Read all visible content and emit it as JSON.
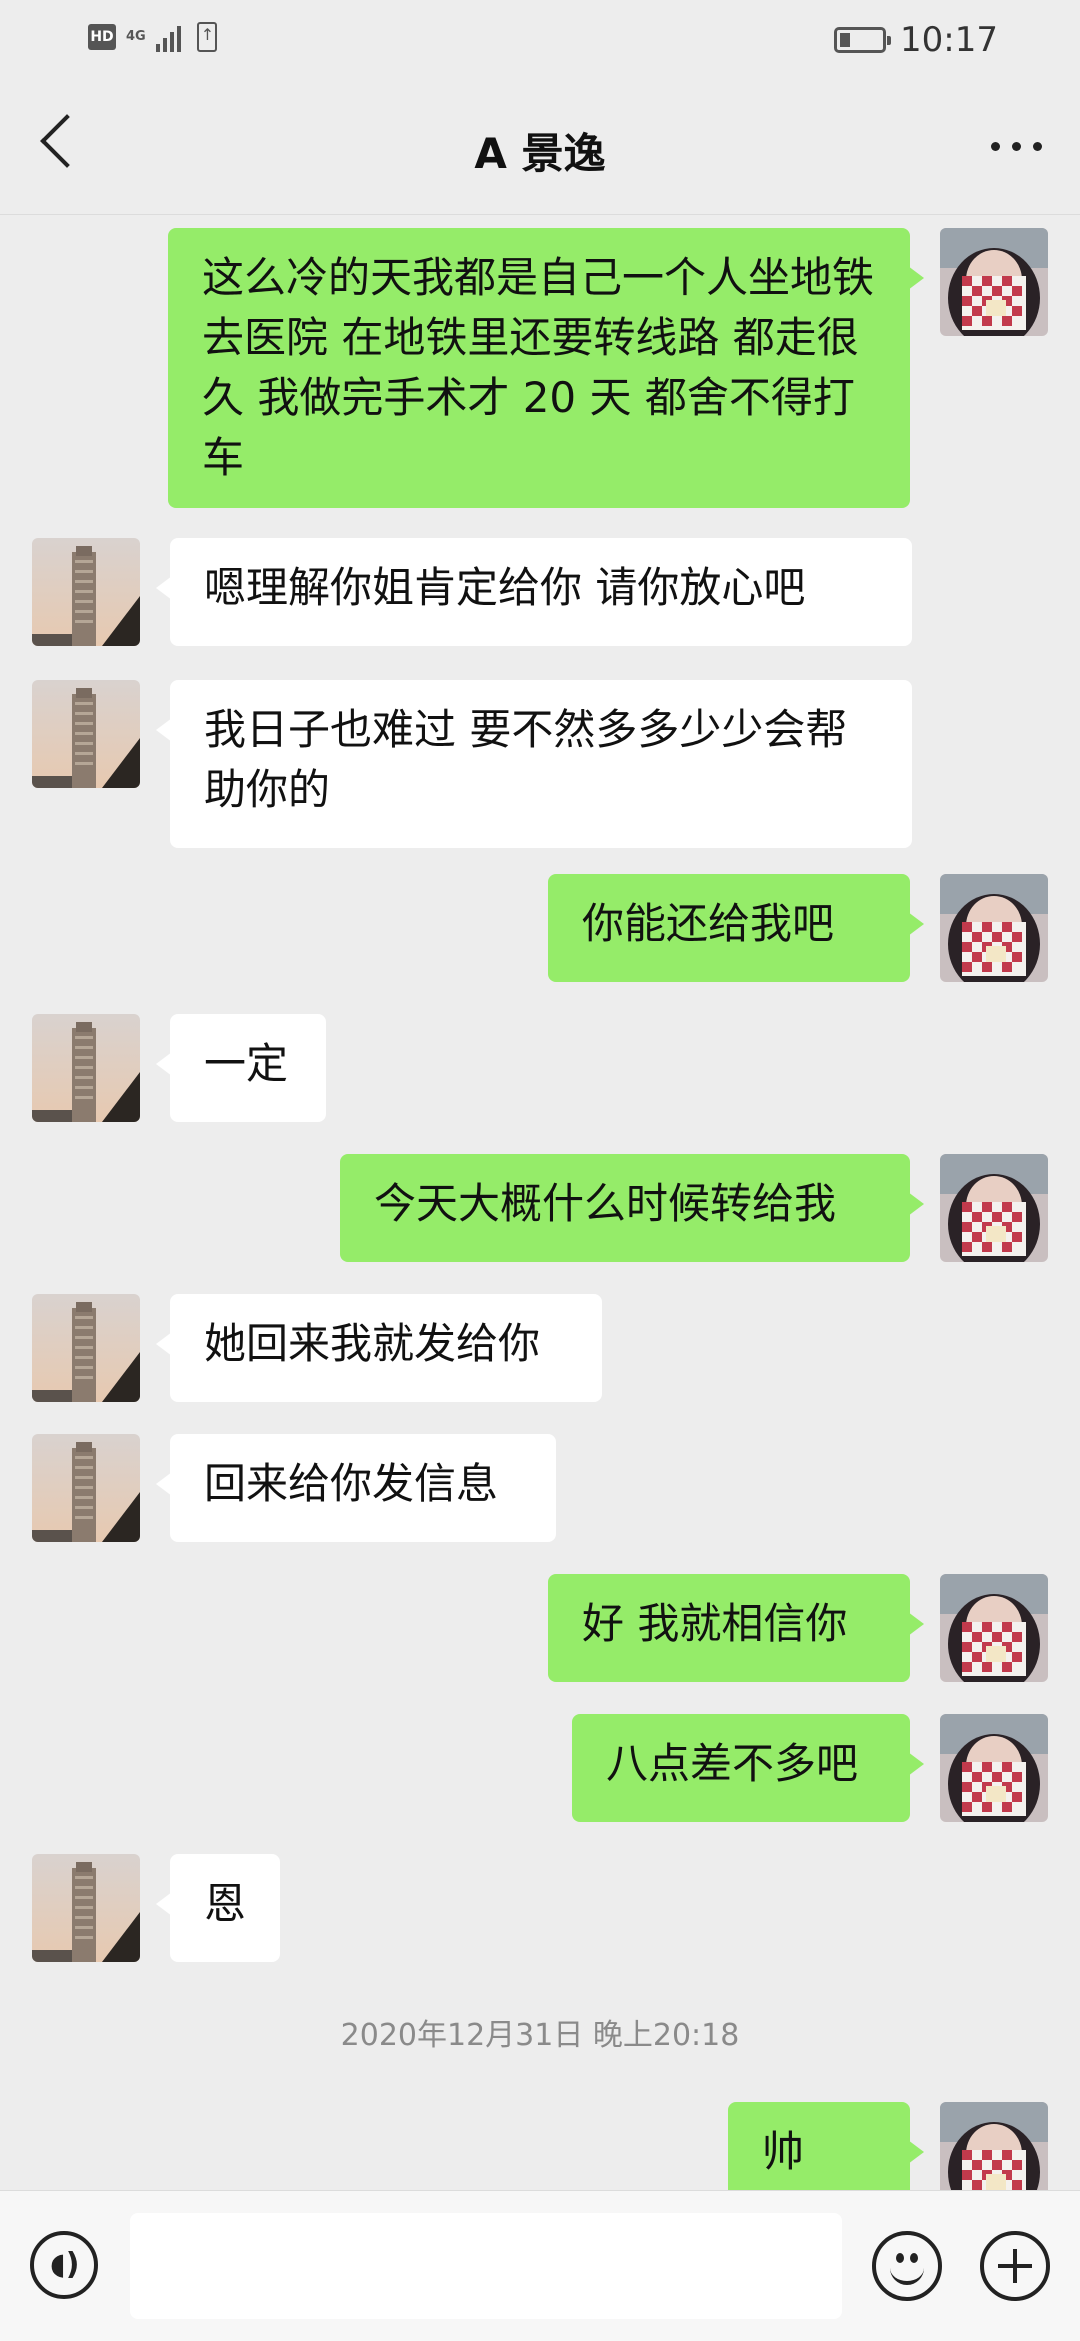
{
  "status_bar": {
    "hd": "HD",
    "network": "4G",
    "time": "10:17"
  },
  "header": {
    "title": "A 景逸"
  },
  "messages": [
    {
      "side": "sent",
      "text": "这么冷的天我都是自己一个人坐地铁去医院  在地铁里还要转线路 都走很久 我做完手术才 20 天  都舍不得打车"
    },
    {
      "side": "recv",
      "text": "嗯理解你姐肯定给你 请你放心吧"
    },
    {
      "side": "recv",
      "text": "我日子也难过 要不然多多少少会帮助你的"
    },
    {
      "side": "sent",
      "text": "你能还给我吧"
    },
    {
      "side": "recv",
      "text": "一定"
    },
    {
      "side": "sent",
      "text": "今天大概什么时候转给我"
    },
    {
      "side": "recv",
      "text": "她回来我就发给你"
    },
    {
      "side": "recv",
      "text": "回来给你发信息"
    },
    {
      "side": "sent",
      "text": "好  我就相信你"
    },
    {
      "side": "sent",
      "text": "八点差不多吧"
    },
    {
      "side": "recv",
      "text": "恩"
    },
    {
      "side": "sent",
      "text": "帅哥？"
    }
  ],
  "timestamp": "2020年12月31日 晚上20:18",
  "input": {
    "placeholder": ""
  },
  "icons": {
    "back": "back-arrow-icon",
    "more": "more-dots-icon",
    "voice": "voice-icon",
    "emoji": "emoji-icon",
    "plus": "plus-icon"
  },
  "colors": {
    "background": "#ededed",
    "sent_bubble": "#95ec69",
    "recv_bubble": "#ffffff",
    "timestamp_text": "#8a8a8a"
  }
}
